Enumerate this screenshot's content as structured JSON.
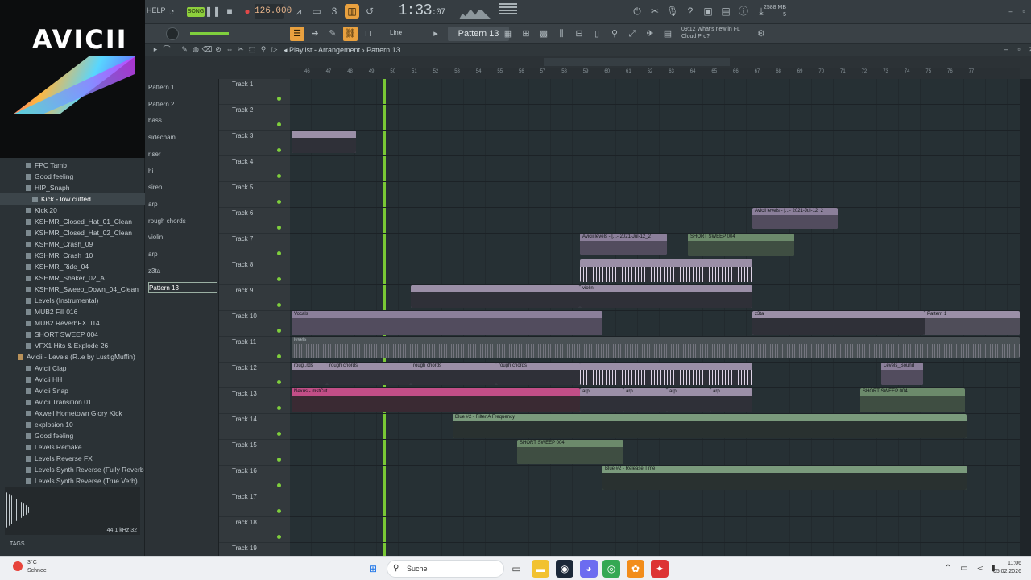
{
  "topbar": {
    "help_label": "HELP",
    "song_label": "SONG",
    "bpm": "126.000",
    "time_main": "1:33",
    "time_sub": ":07",
    "mem_line1": "2588 MB",
    "mem_line2": "5"
  },
  "toolbar2": {
    "snap_label": "Line",
    "pattern_label": "Pattern 13",
    "news_line1": "09:12  What's new in FL",
    "news_line2": "Cloud Pro?"
  },
  "logo": {
    "text": "AVICII"
  },
  "browser": {
    "items": [
      {
        "label": "FPC Tamb",
        "type": "file"
      },
      {
        "label": "Good feeling",
        "type": "file"
      },
      {
        "label": "HIP_Snaph",
        "type": "file"
      },
      {
        "label": "Kick - low cutted",
        "type": "file",
        "selected": true
      },
      {
        "label": "Kick 20",
        "type": "file"
      },
      {
        "label": "KSHMR_Closed_Hat_01_Clean",
        "type": "file"
      },
      {
        "label": "KSHMR_Closed_Hat_02_Clean",
        "type": "file"
      },
      {
        "label": "KSHMR_Crash_09",
        "type": "file"
      },
      {
        "label": "KSHMR_Crash_10",
        "type": "file"
      },
      {
        "label": "KSHMR_Ride_04",
        "type": "file"
      },
      {
        "label": "KSHMR_Shaker_02_A",
        "type": "file"
      },
      {
        "label": "KSHMR_Sweep_Down_04_Clean",
        "type": "file"
      },
      {
        "label": "Levels (Instrumental)",
        "type": "file"
      },
      {
        "label": "MUB2 Fill 016",
        "type": "file"
      },
      {
        "label": "MUB2 ReverbFX 014",
        "type": "file"
      },
      {
        "label": "SHORT SWEEP 004",
        "type": "file"
      },
      {
        "label": "VFX1 Hits & Explode 26",
        "type": "file"
      },
      {
        "label": "Avicii - Levels (R..e by LustigMuffin)",
        "type": "folder"
      },
      {
        "label": "Avicii Clap",
        "type": "file"
      },
      {
        "label": "Avicii HH",
        "type": "file"
      },
      {
        "label": "Avicii Snap",
        "type": "file"
      },
      {
        "label": "Avicii Transition 01",
        "type": "file"
      },
      {
        "label": "Axwell Hometown Glory Kick",
        "type": "file"
      },
      {
        "label": "explosion 10",
        "type": "file"
      },
      {
        "label": "Good feeling",
        "type": "file"
      },
      {
        "label": "Levels Remake",
        "type": "file"
      },
      {
        "label": "Levels Reverse FX",
        "type": "file"
      },
      {
        "label": "Levels Synth Reverse (Fully Reverb 2)",
        "type": "file"
      },
      {
        "label": "Levels Synth Reverse (True Verb)",
        "type": "file"
      }
    ],
    "freq_label": "44.1 kHz 32",
    "tags_label": "TAGS"
  },
  "playlist": {
    "title": "Playlist - Arrangement",
    "pattern": "Pattern 13",
    "ruler_marks": [
      "46",
      "47",
      "48",
      "49",
      "50",
      "51",
      "52",
      "53",
      "54",
      "55",
      "56",
      "57",
      "58",
      "59",
      "60",
      "61",
      "62",
      "63",
      "64",
      "65",
      "66",
      "67",
      "68",
      "69",
      "70",
      "71",
      "72",
      "73",
      "74",
      "75",
      "76",
      "77"
    ]
  },
  "picker": {
    "items": [
      "Pattern 1",
      "Pattern 2",
      "bass",
      "sidechain",
      "riser",
      "hi",
      "siren",
      "arp",
      "rough chords",
      "violin",
      "arp",
      "z3ta",
      "Pattern 13"
    ]
  },
  "tracks": [
    "Track 1",
    "Track 2",
    "Track 3",
    "Track 4",
    "Track 5",
    "Track 6",
    "Track 7",
    "Track 8",
    "Track 9",
    "Track 10",
    "Track 11",
    "Track 12",
    "Track 13",
    "Track 14",
    "Track 15",
    "Track 16",
    "Track 17",
    "Track 18",
    "Track 19"
  ],
  "clips": {
    "avicii_levels_a": "Avicii levels - [...- 2021-Jul-12_2",
    "avicii_levels_b": "Avicii levels - [...- 2021-Jul-12_2",
    "short_sweep_1": "SHORT SWEEP 004",
    "short_sweep_2": "SHORT SWEEP 004",
    "short_sweep_3": "SHORT SWEEP 004",
    "vocals": "Vocals",
    "levels": "levels",
    "rough_chords_1": "roug..rds",
    "rough_chords_2": "rough chords",
    "rough_chords_3": "rough chords",
    "rough_chords_4": "rough chords",
    "violin_1": "violin",
    "violin_2": "violin",
    "z3ta": "z3ta",
    "pattern1": "Pattern 1",
    "levels_sound": "Levels_Sound",
    "nexus": "Nexus - mstCut",
    "arp_1": "arp",
    "arp_2": "arp",
    "arp_3": "arp",
    "arp_4": "arp",
    "blue_filter": "Blue #2 - Filter A Frequency",
    "blue_release": "Blue #2 - Release Time"
  },
  "taskbar": {
    "weather_temp": "3°C",
    "weather_desc": "Schnee",
    "search_label": "Suche",
    "clock_time": "11:06",
    "clock_date": "05.02.2026"
  },
  "colors": {
    "accent_green": "#79c935",
    "accent_orange": "#e9a13f",
    "clip_purple": "#9b8fa7",
    "clip_pink": "#c24e87"
  }
}
